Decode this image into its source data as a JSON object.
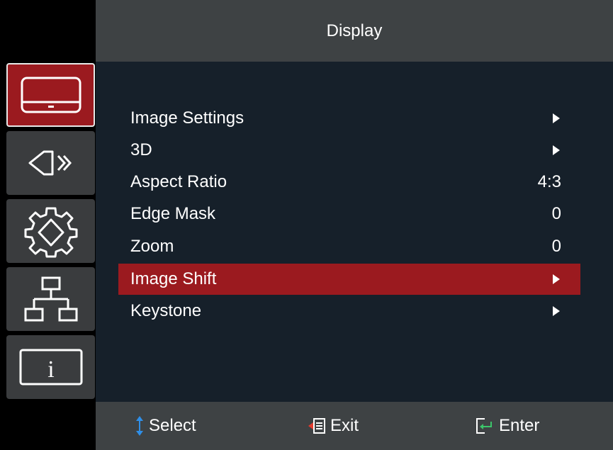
{
  "header": {
    "title": "Display"
  },
  "sidebar": {
    "items": [
      {
        "icon": "display-icon",
        "active": true
      },
      {
        "icon": "audio-icon",
        "active": false
      },
      {
        "icon": "settings-gear-icon",
        "active": false
      },
      {
        "icon": "network-icon",
        "active": false
      },
      {
        "icon": "info-icon",
        "active": false
      }
    ]
  },
  "menu": {
    "items": [
      {
        "label": "Image Settings",
        "value": "",
        "submenu": true
      },
      {
        "label": "3D",
        "value": "",
        "submenu": true
      },
      {
        "label": "Aspect Ratio",
        "value": "4:3",
        "submenu": false
      },
      {
        "label": "Edge Mask",
        "value": "0",
        "submenu": false
      },
      {
        "label": "Zoom",
        "value": "0",
        "submenu": false
      },
      {
        "label": "Image Shift",
        "value": "",
        "submenu": true,
        "selected": true
      },
      {
        "label": "Keystone",
        "value": "",
        "submenu": true
      }
    ]
  },
  "footer": {
    "select_label": "Select",
    "exit_label": "Exit",
    "enter_label": "Enter"
  },
  "colors": {
    "accent": "#9b1a1f",
    "header_bg": "#3e4244",
    "panel_bg": "#16202a",
    "select_icon": "#2f8fe8",
    "exit_icon": "#e23b2f",
    "enter_icon": "#3cc56a"
  }
}
